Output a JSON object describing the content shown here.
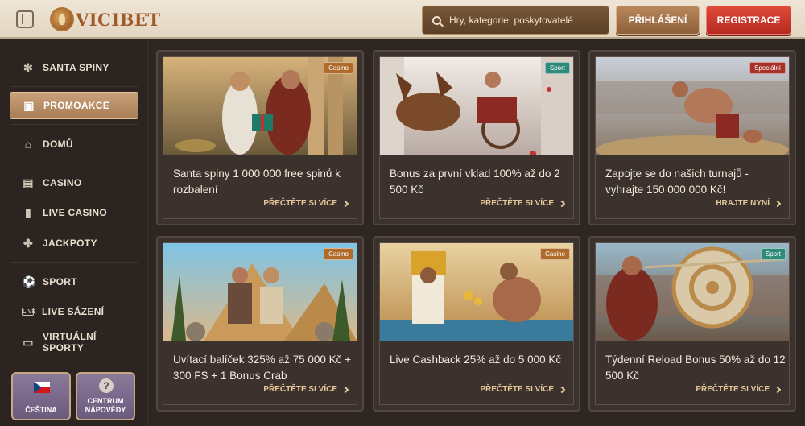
{
  "header": {
    "logo_text": "VICIBET",
    "search_placeholder": "Hry, kategorie, poskytovatelé",
    "login_label": "PŘIHLÁŠENÍ",
    "register_label": "REGISTRACE"
  },
  "sidebar": {
    "items": [
      {
        "label": "SANTA SPINY",
        "icon": "snowflake-icon"
      },
      {
        "label": "PROMOAKCE",
        "icon": "gift-icon",
        "active": true
      },
      {
        "label": "DOMŮ",
        "icon": "home-icon"
      },
      {
        "label": "CASINO",
        "icon": "slot-machine-icon"
      },
      {
        "label": "LIVE CASINO",
        "icon": "playing-card-icon"
      },
      {
        "label": "JACKPOTY",
        "icon": "clover-icon"
      },
      {
        "label": "SPORT",
        "icon": "soccer-ball-icon"
      },
      {
        "label": "LIVE SÁZENÍ",
        "icon": "live-icon"
      },
      {
        "label": "VIRTUÁLNÍ SPORTY",
        "icon": "virtual-sport-icon"
      }
    ],
    "language_label": "ČEŠTINA",
    "help_label": "CENTRUM NÁPOVĚDY",
    "help_glyph": "?"
  },
  "cards": [
    {
      "badge": "Casino",
      "title": "Santa spiny 1 000 000 free spinů k rozbalení",
      "link": "PŘEČTĚTE SI VÍCE"
    },
    {
      "badge": "Sport",
      "title": "Bonus za první vklad 100% až do 2 500 Kč",
      "link": "PŘEČTĚTE SI VÍCE"
    },
    {
      "badge": "Speciální",
      "title": "Zapojte se do našich turnajů - vyhrajte 150 000 000 Kč!",
      "link": "HRAJTE NYNÍ"
    },
    {
      "badge": "Casino",
      "title": "Uvítací balíček 325% až 75 000 Kč + 300 FS + 1 Bonus Crab",
      "link": "PŘEČTĚTE SI VÍCE"
    },
    {
      "badge": "Casino",
      "title": "Live Cashback 25% až do 5 000 Kč",
      "link": "PŘEČTĚTE SI VÍCE"
    },
    {
      "badge": "Sport",
      "title": "Týdenní Reload Bonus 50% až do 12 500 Kč",
      "link": "PŘEČTĚTE SI VÍCE"
    }
  ]
}
